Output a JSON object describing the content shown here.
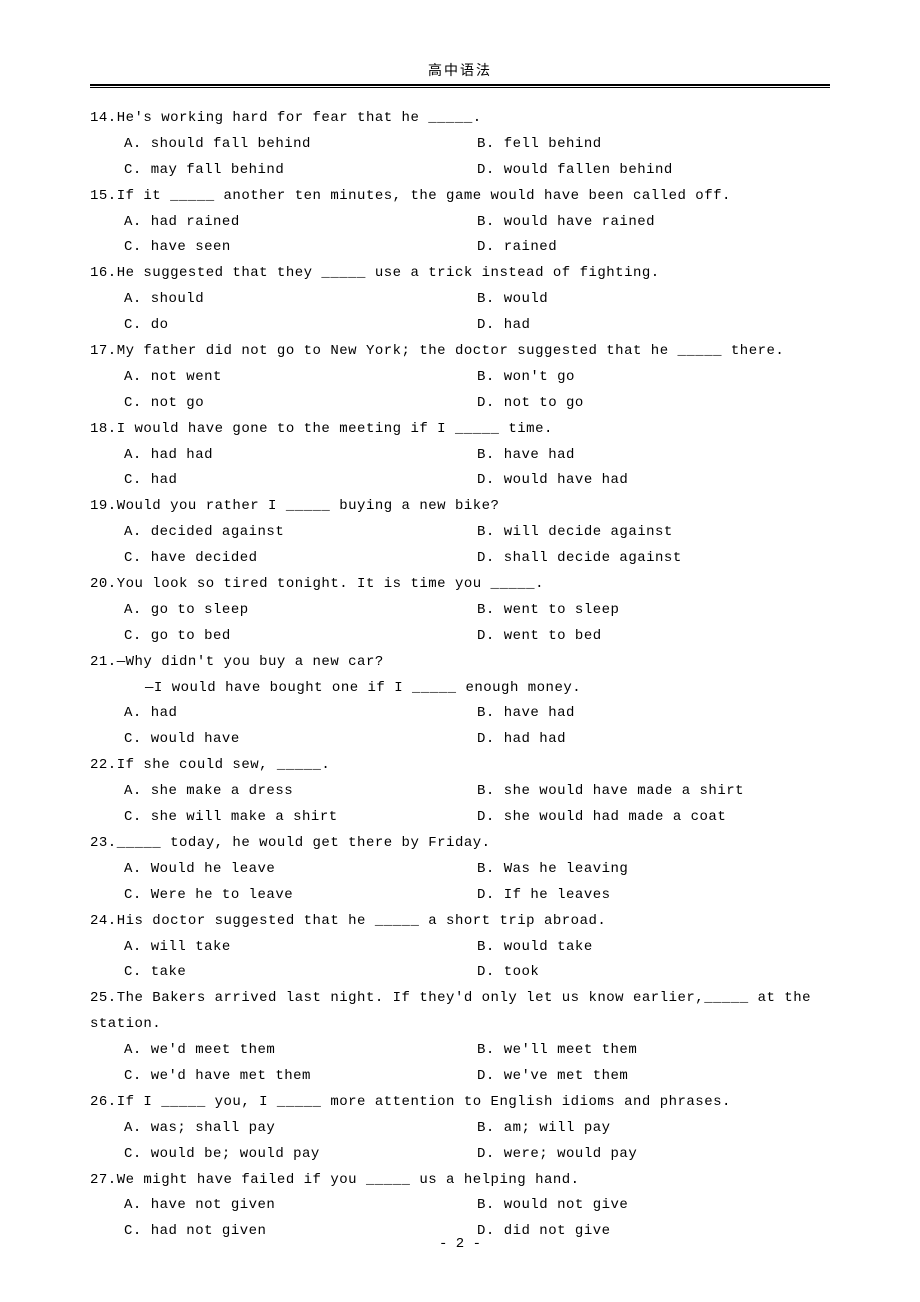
{
  "header": "高中语法",
  "footer": "- 2 -",
  "questions": [
    {
      "n": "14",
      "text": "14.He's working hard for fear that he _____.",
      "options": [
        "A. should fall behind",
        "B. fell behind",
        "C. may fall behind",
        "D. would fallen behind"
      ],
      "cols": "col2"
    },
    {
      "n": "15",
      "text": "15.If it _____ another ten minutes, the game would have been called off.",
      "options": [
        "A. had rained",
        "B. would have rained",
        "C. have seen",
        "D. rained"
      ],
      "cols": "col2"
    },
    {
      "n": "16",
      "text": "16.He suggested that they _____ use a trick instead of fighting.",
      "options": [
        "A. should",
        "B. would",
        "C. do",
        "D. had"
      ],
      "cols": "col2"
    },
    {
      "n": "17",
      "text": "17.My father did not go to New York; the doctor suggested that he _____ there.",
      "options": [
        "A. not went",
        "B. won't go",
        "C. not go",
        "D. not to go"
      ],
      "cols": "col2"
    },
    {
      "n": "18",
      "text": "18.I would have gone to the meeting if I _____ time.",
      "options": [
        "A. had had",
        "B. have had",
        "C. had",
        "D. would have had"
      ],
      "cols": "col2"
    },
    {
      "n": "19",
      "text": "19.Would you rather I _____ buying a new bike?",
      "options": [
        "A. decided against",
        "B. will decide against",
        "C. have decided",
        "D. shall decide against"
      ],
      "cols": "col2"
    },
    {
      "n": "20",
      "text": "20.You look so tired tonight. It is time you _____.",
      "options": [
        "A. go to sleep",
        "B. went to sleep",
        "C. go to bed",
        "D. went to bed"
      ],
      "cols": "col2"
    },
    {
      "n": "21",
      "text": "21.—Why didn't you buy a new car?",
      "extra": [
        "—I would have bought one if I _____ enough money."
      ],
      "options": [
        "A. had",
        "B. have had",
        "C. would have",
        "D. had had"
      ],
      "cols": "col2"
    },
    {
      "n": "22",
      "text": "22.If she could sew, _____.",
      "options": [
        "A. she make a dress",
        "B. she would have made a shirt",
        "C. she will make a shirt",
        "D. she would had made a coat"
      ],
      "cols": "col2"
    },
    {
      "n": "23",
      "text": "23._____ today, he would get there by Friday.",
      "options": [
        "A. Would he leave",
        "B. Was he leaving",
        "C. Were he to leave",
        "D. If he leaves"
      ],
      "cols": "col2"
    },
    {
      "n": "24",
      "text": "24.His doctor suggested that he _____ a short trip abroad.",
      "options": [
        "A. will take",
        "B. would take",
        "C. take",
        "D. took"
      ],
      "cols": "col2"
    },
    {
      "n": "25",
      "text": "25.The Bakers arrived last night. If they'd only let us know earlier,_____ at the",
      "extra_noindent": [
        "station."
      ],
      "options": [
        "A. we'd meet them",
        "B. we'll meet them",
        "C. we'd have met them",
        "D. we've met them"
      ],
      "cols": "col2"
    },
    {
      "n": "26",
      "text": "26.If I _____ you, I _____ more attention to English idioms and phrases.",
      "options": [
        "A. was; shall pay",
        "B. am; will pay",
        "C. would be; would pay",
        "D. were; would pay"
      ],
      "cols": "col2"
    },
    {
      "n": "27",
      "text": "27.We might have failed if you _____ us a helping hand.",
      "options": [
        "A. have not given",
        "B. would not give",
        "C. had not given",
        "D. did not give"
      ],
      "cols": "col2"
    }
  ]
}
